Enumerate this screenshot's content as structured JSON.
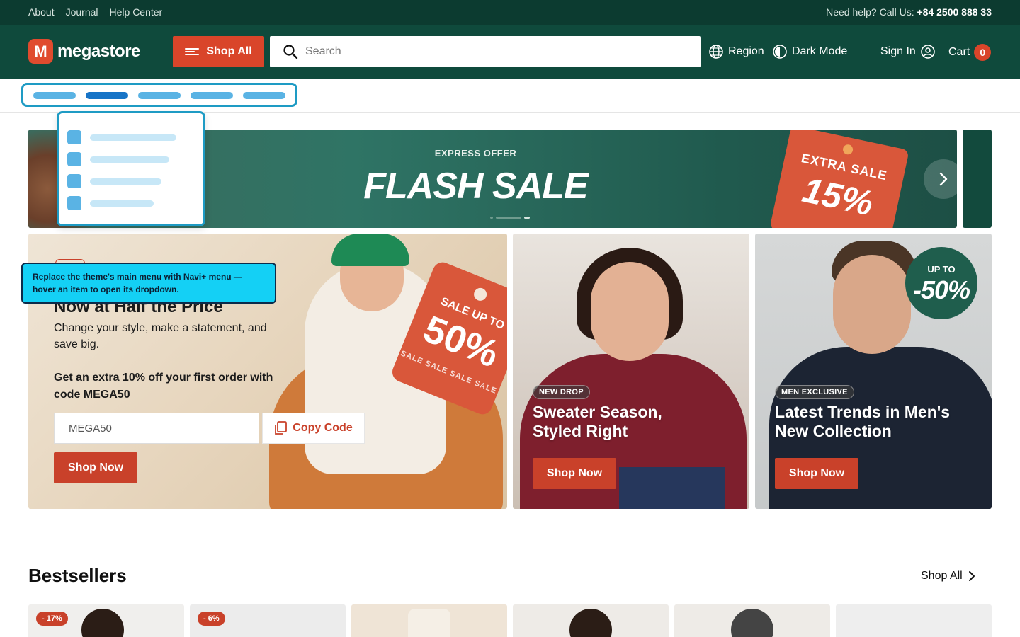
{
  "topbar": {
    "links": [
      "About",
      "Journal",
      "Help Center"
    ],
    "help_prefix": "Need help? Call Us:",
    "phone": "+84 2500 888 33"
  },
  "header": {
    "logo_letter": "M",
    "logo_name": "megastore",
    "shop_all": "Shop All",
    "search_placeholder": "Search",
    "region": "Region",
    "dark_mode": "Dark Mode",
    "sign_in": "Sign In",
    "cart": "Cart",
    "cart_count": "0"
  },
  "flash": {
    "eyebrow": "EXPRESS OFFER",
    "title": "FLASH SALE",
    "tag_line1": "EXTRA SALE",
    "tag_line2": "15%"
  },
  "hero": {
    "heading": "Now at Half the Price",
    "subtext": "Change your style, make a statement, and save big.",
    "code_text": "Get an extra 10% off your first order with code MEGA50",
    "code_value": "MEGA50",
    "copy_label": "Copy Code",
    "shop_now": "Shop Now",
    "tag_line1": "SALE UP TO",
    "tag_line2": "50%",
    "tag_line3": "SALE SALE SALE SALE"
  },
  "cards": [
    {
      "badge": "NEW DROP",
      "title_line1": "Sweater Season,",
      "title_line2": "Styled Right",
      "button": "Shop Now"
    },
    {
      "badge": "MEN EXCLUSIVE",
      "title_line1": "Latest Trends in Men's",
      "title_line2": "New Collection",
      "button": "Shop Now",
      "upto_label": "UP TO",
      "upto_value": "-50%"
    }
  ],
  "tooltip": "Replace the theme's main menu with Navi+ menu — hover an item to open its dropdown.",
  "bestsellers": {
    "title": "Bestsellers",
    "shop_all": "Shop All",
    "discounts": [
      "- 17%",
      "- 6%"
    ]
  },
  "colors": {
    "topbar": "#0c3b30",
    "header": "#0f4a3c",
    "accent": "#d9452a",
    "highlight": "#14d0f5"
  }
}
